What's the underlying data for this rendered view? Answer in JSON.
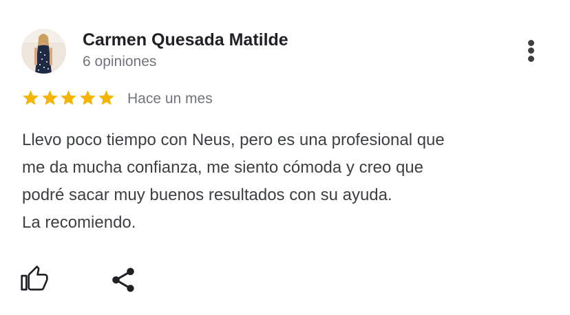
{
  "author": {
    "name": "Carmen Quesada Matilde",
    "review_count": "6 opiniones"
  },
  "review": {
    "rating": 5,
    "max_rating": 5,
    "date": "Hace un mes",
    "text": "Llevo poco tiempo con Neus, pero es una profesional que\nme da mucha confianza, me siento cómoda y creo que\npodré sacar muy buenos resultados con su ayuda.\nLa recomiendo."
  },
  "icons": {
    "more": "more-vert-icon",
    "star": "star-icon",
    "like": "thumb-up-icon",
    "share": "share-icon"
  },
  "colors": {
    "star": "#f4b400",
    "name": "#202124",
    "secondary": "#70757a",
    "body": "#3c4043"
  }
}
